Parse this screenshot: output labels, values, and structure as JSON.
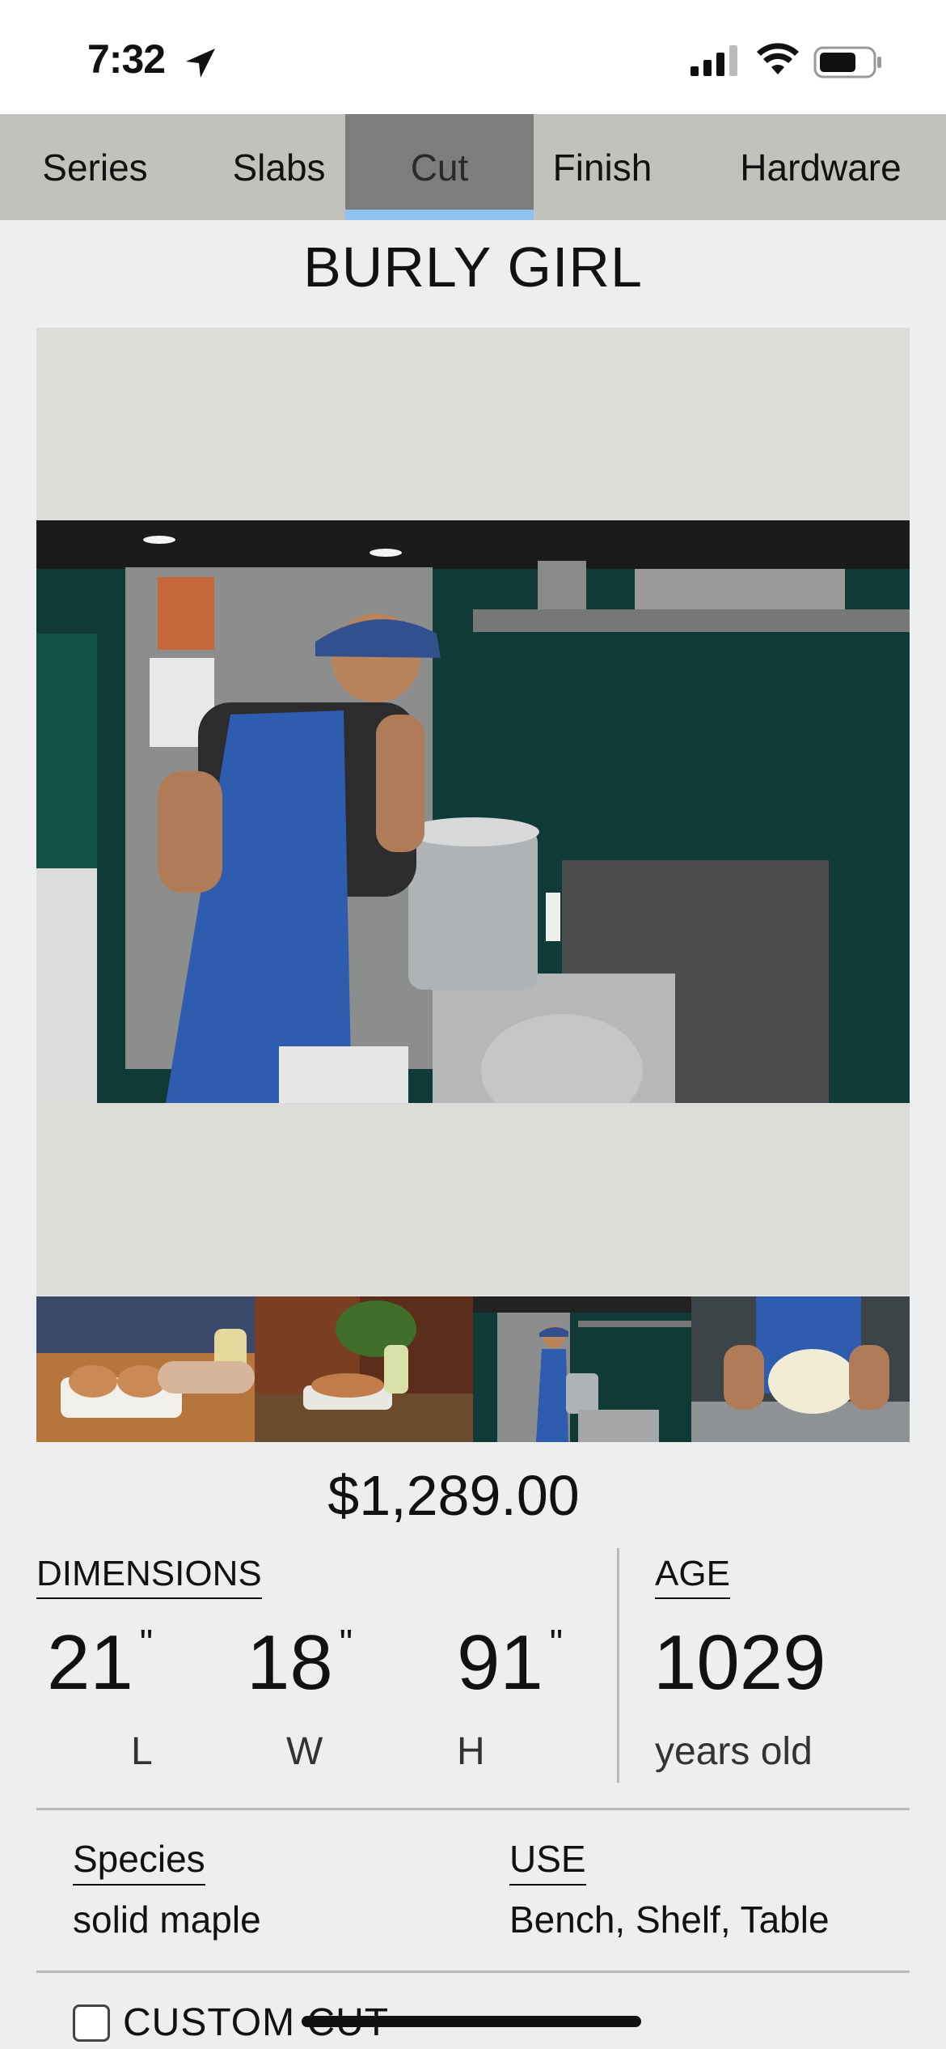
{
  "status": {
    "time": "7:32"
  },
  "tabs": [
    {
      "label": "Series",
      "active": false
    },
    {
      "label": "Slabs",
      "active": false
    },
    {
      "label": "Cut",
      "active": true
    },
    {
      "label": "Finish",
      "active": false
    },
    {
      "label": "Hardware",
      "active": false
    }
  ],
  "product": {
    "title": "BURLY GIRL",
    "price": "$1,289.00"
  },
  "dimensions": {
    "label": "DIMENSIONS",
    "length": "21",
    "width": "18",
    "height": "91",
    "inch_mark": "\"",
    "length_unit": "L",
    "width_unit": "W",
    "height_unit": "H"
  },
  "age": {
    "label": "AGE",
    "value": "1029",
    "unit": "years old"
  },
  "species": {
    "label": "Species",
    "value": "solid maple"
  },
  "use": {
    "label": "USE",
    "value": "Bench, Shelf, Table"
  },
  "custom_cut": {
    "label": "CUSTOM CUT",
    "checked": false
  },
  "colors": {
    "tab_active": "#7d7d7b",
    "tab_indicator": "#8fc2f0",
    "tab_bar": "#c2c2bc"
  }
}
